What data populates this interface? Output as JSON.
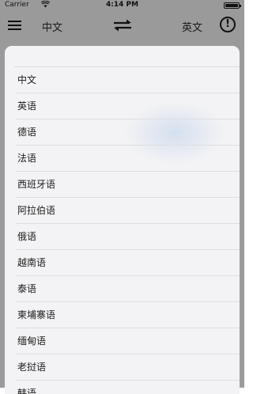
{
  "status_bar": {
    "carrier": "Carrier",
    "wifi_icon": "wifi-icon",
    "time": "4:14 PM",
    "battery_icon": "battery-icon"
  },
  "nav": {
    "menu_icon": "menu-icon",
    "source_language": "中文",
    "swap_icon": "swap-arrows-icon",
    "target_language": "英文",
    "info_icon": "info-icon",
    "info_glyph": "!"
  },
  "languages": [
    "中文",
    "英语",
    "德语",
    "法语",
    "西班牙语",
    "阿拉伯语",
    "俄语",
    "越南语",
    "泰语",
    "柬埔寨语",
    "缅甸语",
    "老挝语",
    "韩语"
  ],
  "colors": {
    "backdrop": "#9a9a9a",
    "sheet": "#f3f3f5",
    "separator": "#dedede",
    "text": "#1a1a1a"
  }
}
